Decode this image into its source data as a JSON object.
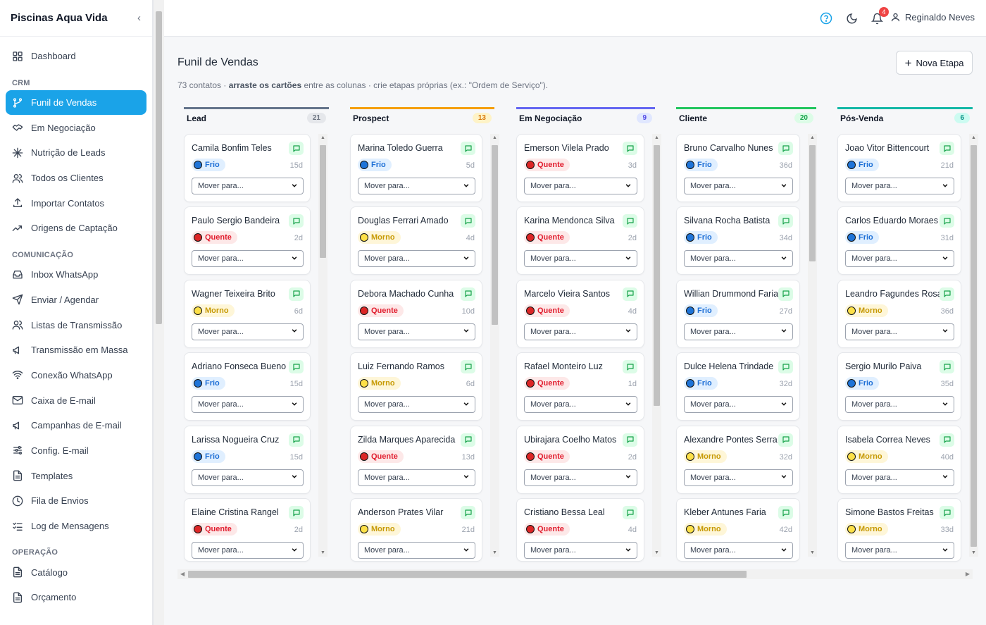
{
  "app": {
    "title": "Piscinas Aqua Vida"
  },
  "user": {
    "name": "Reginaldo Neves",
    "notifications": "4"
  },
  "sidebar": {
    "top": [
      {
        "label": "Dashboard",
        "icon": "grid-icon"
      }
    ],
    "sections": [
      {
        "title": "CRM",
        "items": [
          {
            "label": "Funil de Vendas",
            "icon": "funnel-icon",
            "active": true
          },
          {
            "label": "Em Negociação",
            "icon": "handshake-icon"
          },
          {
            "label": "Nutrição de Leads",
            "icon": "snowflake-icon"
          },
          {
            "label": "Todos os Clientes",
            "icon": "users-icon"
          },
          {
            "label": "Importar Contatos",
            "icon": "upload-icon"
          },
          {
            "label": "Origens de Captação",
            "icon": "trending-icon"
          }
        ]
      },
      {
        "title": "COMUNICAÇÃO",
        "items": [
          {
            "label": "Inbox WhatsApp",
            "icon": "inbox-icon"
          },
          {
            "label": "Enviar / Agendar",
            "icon": "send-icon"
          },
          {
            "label": "Listas de Transmissão",
            "icon": "users-icon"
          },
          {
            "label": "Transmissão em Massa",
            "icon": "megaphone-icon"
          },
          {
            "label": "Conexão WhatsApp",
            "icon": "wifi-icon"
          },
          {
            "label": "Caixa de E-mail",
            "icon": "mail-icon"
          },
          {
            "label": "Campanhas de E-mail",
            "icon": "megaphone-icon"
          },
          {
            "label": "Config. E-mail",
            "icon": "sliders-icon"
          },
          {
            "label": "Templates",
            "icon": "file-icon"
          },
          {
            "label": "Fila de Envios",
            "icon": "clock-icon"
          },
          {
            "label": "Log de Mensagens",
            "icon": "list-check-icon"
          }
        ]
      },
      {
        "title": "OPERAÇÃO",
        "items": [
          {
            "label": "Catálogo",
            "icon": "file-icon"
          },
          {
            "label": "Orçamento",
            "icon": "file-icon"
          }
        ]
      }
    ]
  },
  "main": {
    "title": "Funil de Vendas",
    "subtitle_pre": "73 contatos · ",
    "subtitle_bold": "arraste os cartões",
    "subtitle_post": " entre as colunas · crie etapas próprias (ex.: \"Ordem de Serviço\").",
    "new_stage_label": "Nova Etapa",
    "move_placeholder": "Mover para..."
  },
  "colors": {
    "accent": "#1aa3e8"
  },
  "columns": [
    {
      "title": "Lead",
      "count": "21",
      "color": "#64748b",
      "badge_bg": "#e5e7eb",
      "badge_fg": "#6b7280",
      "cards": [
        {
          "name": "Camila Bonfim Teles",
          "temp": "Frio",
          "days": "15d"
        },
        {
          "name": "Paulo Sergio Bandeira",
          "temp": "Quente",
          "days": "2d"
        },
        {
          "name": "Wagner Teixeira Brito",
          "temp": "Morno",
          "days": "6d"
        },
        {
          "name": "Adriano Fonseca Bueno",
          "temp": "Frio",
          "days": "15d"
        },
        {
          "name": "Larissa Nogueira Cruz",
          "temp": "Frio",
          "days": "15d"
        },
        {
          "name": "Elaine Cristina Rangel",
          "temp": "Quente",
          "days": "2d"
        }
      ]
    },
    {
      "title": "Prospect",
      "count": "13",
      "color": "#f59e0b",
      "badge_bg": "#fef3c7",
      "badge_fg": "#d97706",
      "cards": [
        {
          "name": "Marina Toledo Guerra",
          "temp": "Frio",
          "days": "5d"
        },
        {
          "name": "Douglas Ferrari Amado",
          "temp": "Morno",
          "days": "4d"
        },
        {
          "name": "Debora Machado Cunha",
          "temp": "Quente",
          "days": "10d"
        },
        {
          "name": "Luiz Fernando Ramos",
          "temp": "Morno",
          "days": "6d"
        },
        {
          "name": "Zilda Marques Aparecida",
          "temp": "Quente",
          "days": "13d"
        },
        {
          "name": "Anderson Prates Vilar",
          "temp": "Morno",
          "days": "21d"
        }
      ]
    },
    {
      "title": "Em Negociação",
      "count": "9",
      "color": "#6366f1",
      "badge_bg": "#e0e7ff",
      "badge_fg": "#4f46e5",
      "cards": [
        {
          "name": "Emerson Vilela Prado",
          "temp": "Quente",
          "days": "3d"
        },
        {
          "name": "Karina Mendonca Silva",
          "temp": "Quente",
          "days": "2d"
        },
        {
          "name": "Marcelo Vieira Santos",
          "temp": "Quente",
          "days": "4d"
        },
        {
          "name": "Rafael Monteiro Luz",
          "temp": "Quente",
          "days": "1d"
        },
        {
          "name": "Ubirajara Coelho Matos",
          "temp": "Quente",
          "days": "2d"
        },
        {
          "name": "Cristiano Bessa Leal",
          "temp": "Quente",
          "days": "4d"
        }
      ]
    },
    {
      "title": "Cliente",
      "count": "20",
      "color": "#22c55e",
      "badge_bg": "#dcfce7",
      "badge_fg": "#16a34a",
      "cards": [
        {
          "name": "Bruno Carvalho Nunes",
          "temp": "Frio",
          "days": "36d"
        },
        {
          "name": "Silvana Rocha Batista",
          "temp": "Frio",
          "days": "34d"
        },
        {
          "name": "Willian Drummond Faria",
          "temp": "Frio",
          "days": "27d"
        },
        {
          "name": "Dulce Helena Trindade",
          "temp": "Frio",
          "days": "32d"
        },
        {
          "name": "Alexandre Pontes Serra",
          "temp": "Morno",
          "days": "32d"
        },
        {
          "name": "Kleber Antunes Faria",
          "temp": "Morno",
          "days": "42d"
        }
      ]
    },
    {
      "title": "Pós-Venda",
      "count": "6",
      "color": "#14b8a6",
      "badge_bg": "#ccfbf1",
      "badge_fg": "#0d9488",
      "cards": [
        {
          "name": "Joao Vitor Bittencourt",
          "temp": "Frio",
          "days": "21d"
        },
        {
          "name": "Carlos Eduardo Moraes",
          "temp": "Frio",
          "days": "31d"
        },
        {
          "name": "Leandro Fagundes Rosa",
          "temp": "Morno",
          "days": "36d"
        },
        {
          "name": "Sergio Murilo Paiva",
          "temp": "Frio",
          "days": "35d"
        },
        {
          "name": "Isabela Correa Neves",
          "temp": "Morno",
          "days": "40d"
        },
        {
          "name": "Simone Bastos Freitas",
          "temp": "Morno",
          "days": "33d"
        }
      ]
    }
  ]
}
